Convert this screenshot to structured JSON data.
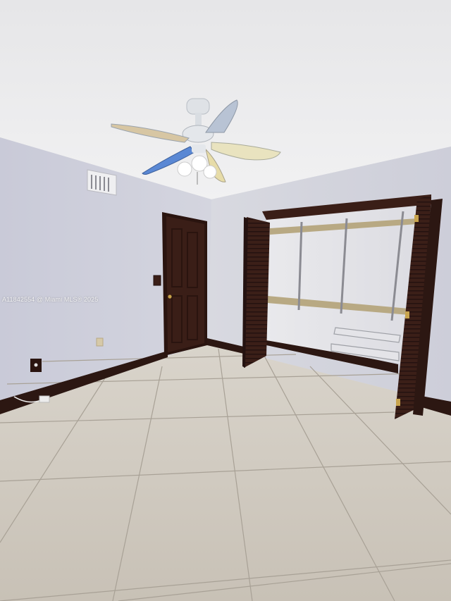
{
  "listing": {
    "watermark": "A11842554 @ Miami MLS® 2025"
  },
  "scene": {
    "room": "empty bedroom",
    "colors": {
      "ceiling": "#ececee",
      "left_wall": "#cfd0dc",
      "right_wall": "#d6d7df",
      "door_wood": "#3a1e17",
      "baseboard": "#2c1712",
      "floor_tile": "#cfc8bd",
      "grout": "#a59e94"
    },
    "icons": [
      "ceiling-fan-icon",
      "air-vent-icon",
      "light-switch-icon",
      "outlet-icon"
    ]
  }
}
